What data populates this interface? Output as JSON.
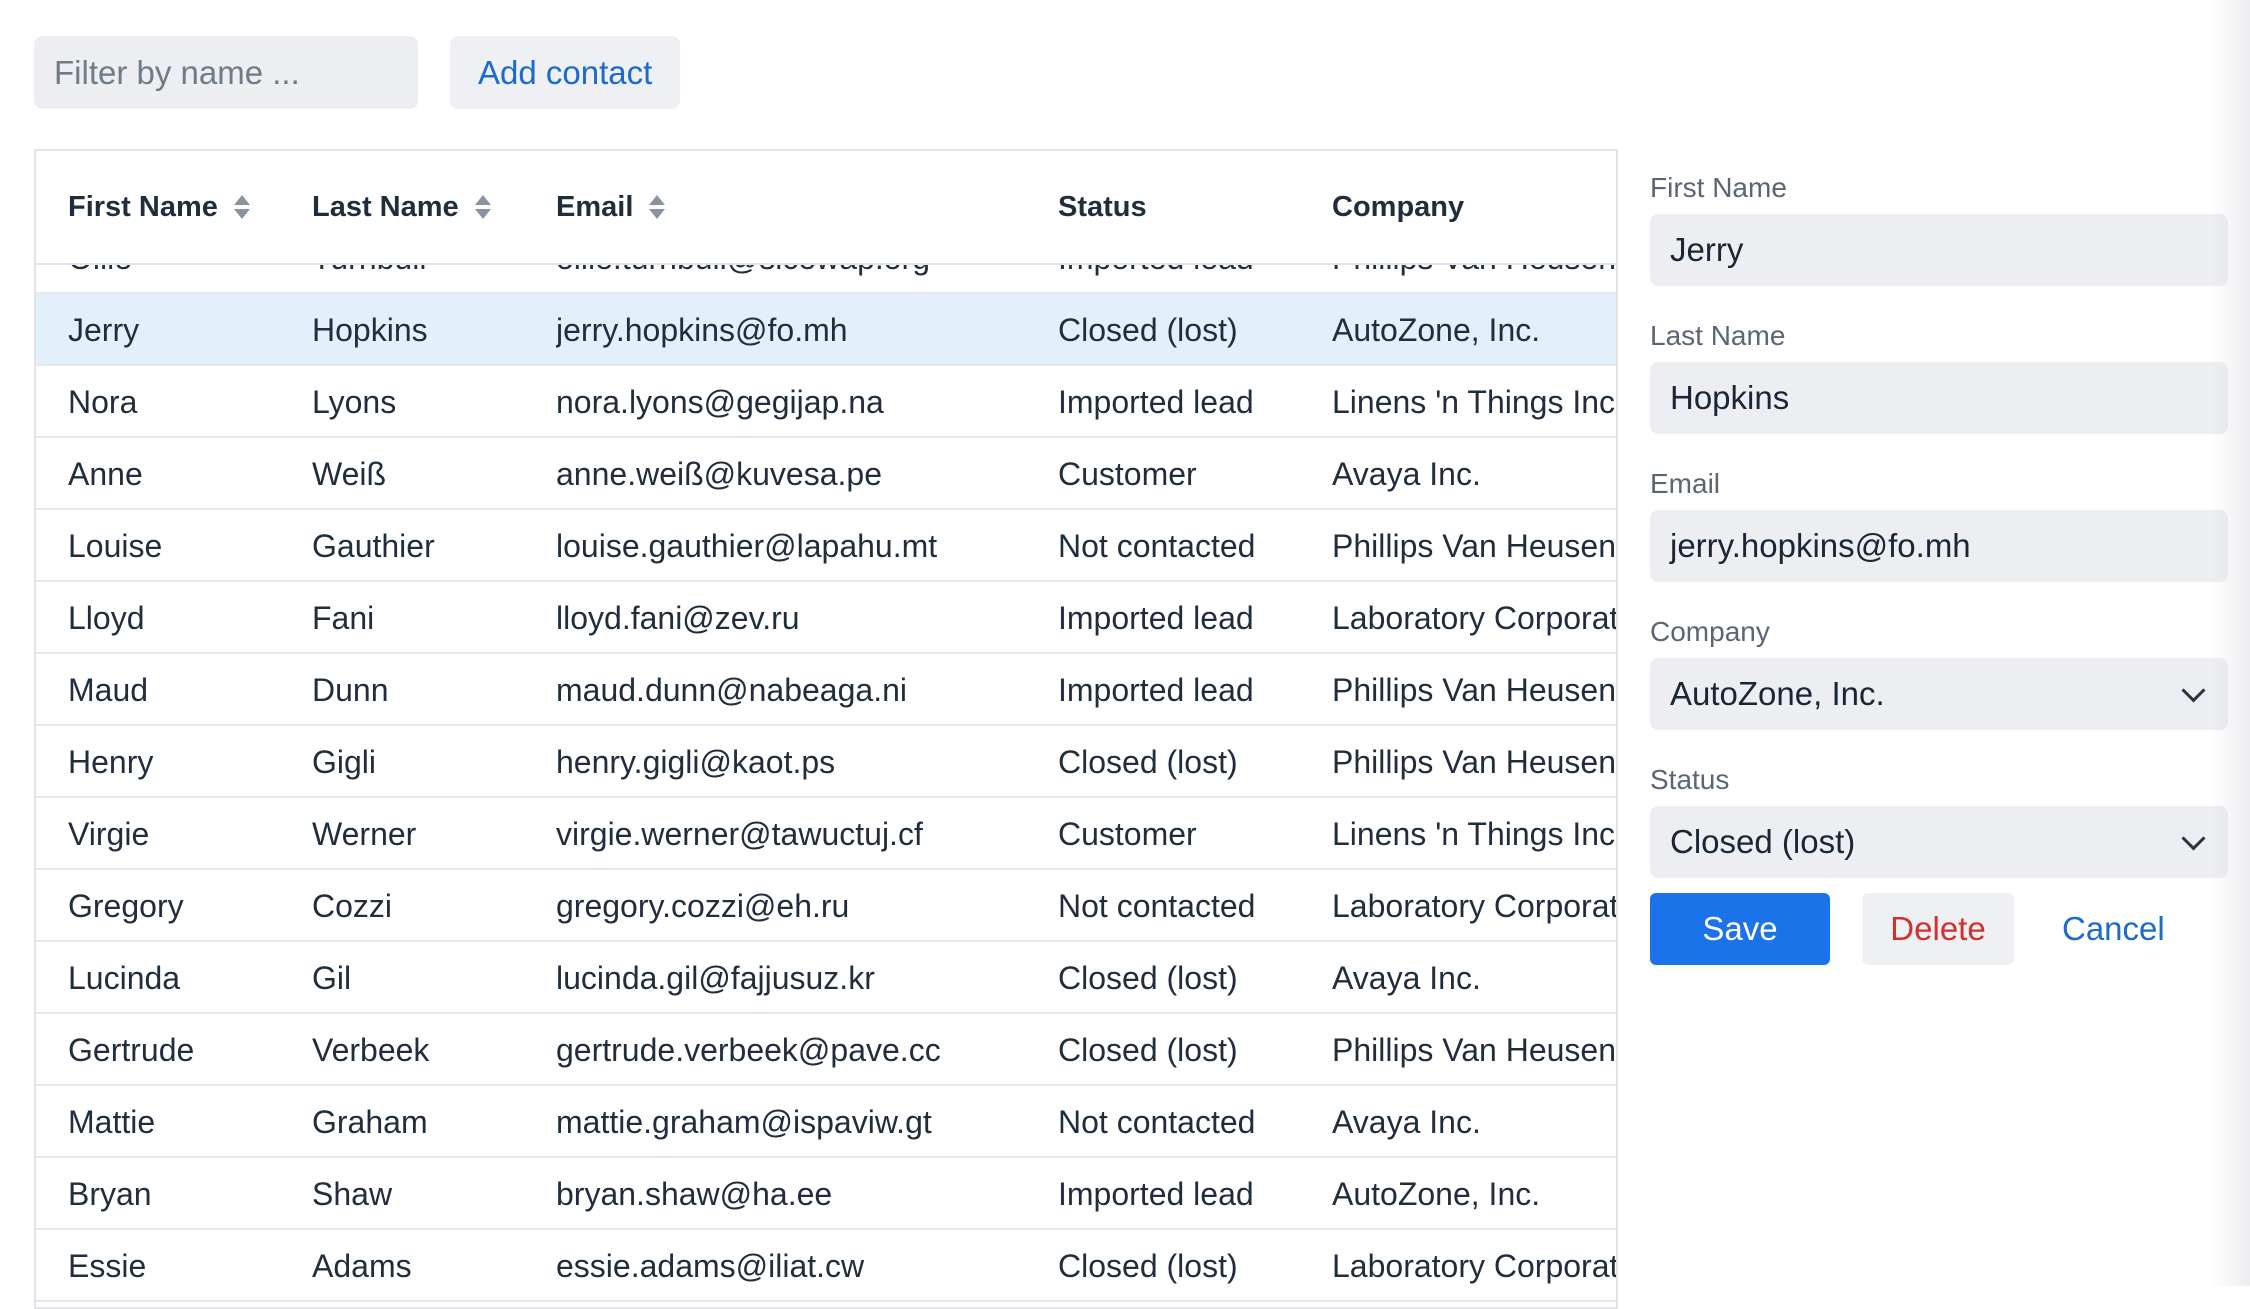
{
  "toolbar": {
    "filter_placeholder": "Filter by name ...",
    "filter_value": "",
    "add_contact_label": "Add contact"
  },
  "grid": {
    "columns": [
      {
        "label": "First Name",
        "sortable": true
      },
      {
        "label": "Last Name",
        "sortable": true
      },
      {
        "label": "Email",
        "sortable": true
      },
      {
        "label": "Status",
        "sortable": false
      },
      {
        "label": "Company",
        "sortable": false
      }
    ],
    "rows": [
      {
        "first": "Ollie",
        "last": "Turnbull",
        "email": "ollie.turnbull@sicewap.org",
        "status": "Imported lead",
        "company": "Phillips Van Heusen"
      },
      {
        "first": "Jerry",
        "last": "Hopkins",
        "email": "jerry.hopkins@fo.mh",
        "status": "Closed (lost)",
        "company": "AutoZone, Inc."
      },
      {
        "first": "Nora",
        "last": "Lyons",
        "email": "nora.lyons@gegijap.na",
        "status": "Imported lead",
        "company": "Linens 'n Things Inc"
      },
      {
        "first": "Anne",
        "last": "Weiß",
        "email": "anne.weiß@kuvesa.pe",
        "status": "Customer",
        "company": "Avaya Inc."
      },
      {
        "first": "Louise",
        "last": "Gauthier",
        "email": "louise.gauthier@lapahu.mt",
        "status": "Not contacted",
        "company": "Phillips Van Heusen"
      },
      {
        "first": "Lloyd",
        "last": "Fani",
        "email": "lloyd.fani@zev.ru",
        "status": "Imported lead",
        "company": "Laboratory Corporation"
      },
      {
        "first": "Maud",
        "last": "Dunn",
        "email": "maud.dunn@nabeaga.ni",
        "status": "Imported lead",
        "company": "Phillips Van Heusen"
      },
      {
        "first": "Henry",
        "last": "Gigli",
        "email": "henry.gigli@kaot.ps",
        "status": "Closed (lost)",
        "company": "Phillips Van Heusen"
      },
      {
        "first": "Virgie",
        "last": "Werner",
        "email": "virgie.werner@tawuctuj.cf",
        "status": "Customer",
        "company": "Linens 'n Things Inc"
      },
      {
        "first": "Gregory",
        "last": "Cozzi",
        "email": "gregory.cozzi@eh.ru",
        "status": "Not contacted",
        "company": "Laboratory Corporation"
      },
      {
        "first": "Lucinda",
        "last": "Gil",
        "email": "lucinda.gil@fajjusuz.kr",
        "status": "Closed (lost)",
        "company": "Avaya Inc."
      },
      {
        "first": "Gertrude",
        "last": "Verbeek",
        "email": "gertrude.verbeek@pave.cc",
        "status": "Closed (lost)",
        "company": "Phillips Van Heusen"
      },
      {
        "first": "Mattie",
        "last": "Graham",
        "email": "mattie.graham@ispaviw.gt",
        "status": "Not contacted",
        "company": "Avaya Inc."
      },
      {
        "first": "Bryan",
        "last": "Shaw",
        "email": "bryan.shaw@ha.ee",
        "status": "Imported lead",
        "company": "AutoZone, Inc."
      },
      {
        "first": "Essie",
        "last": "Adams",
        "email": "essie.adams@iliat.cw",
        "status": "Closed (lost)",
        "company": "Laboratory Corporation"
      }
    ],
    "selected_row_index": 1
  },
  "editor": {
    "first_name_label": "First Name",
    "first_name_value": "Jerry",
    "last_name_label": "Last Name",
    "last_name_value": "Hopkins",
    "email_label": "Email",
    "email_value": "jerry.hopkins@fo.mh",
    "company_label": "Company",
    "company_value": "AutoZone, Inc.",
    "status_label": "Status",
    "status_value": "Closed (lost)",
    "save_label": "Save",
    "delete_label": "Delete",
    "cancel_label": "Cancel"
  },
  "colors": {
    "accent": "#1a73e8",
    "danger": "#d32f2f",
    "selected_row": "#e4effc",
    "input_bg": "#eceef1"
  }
}
